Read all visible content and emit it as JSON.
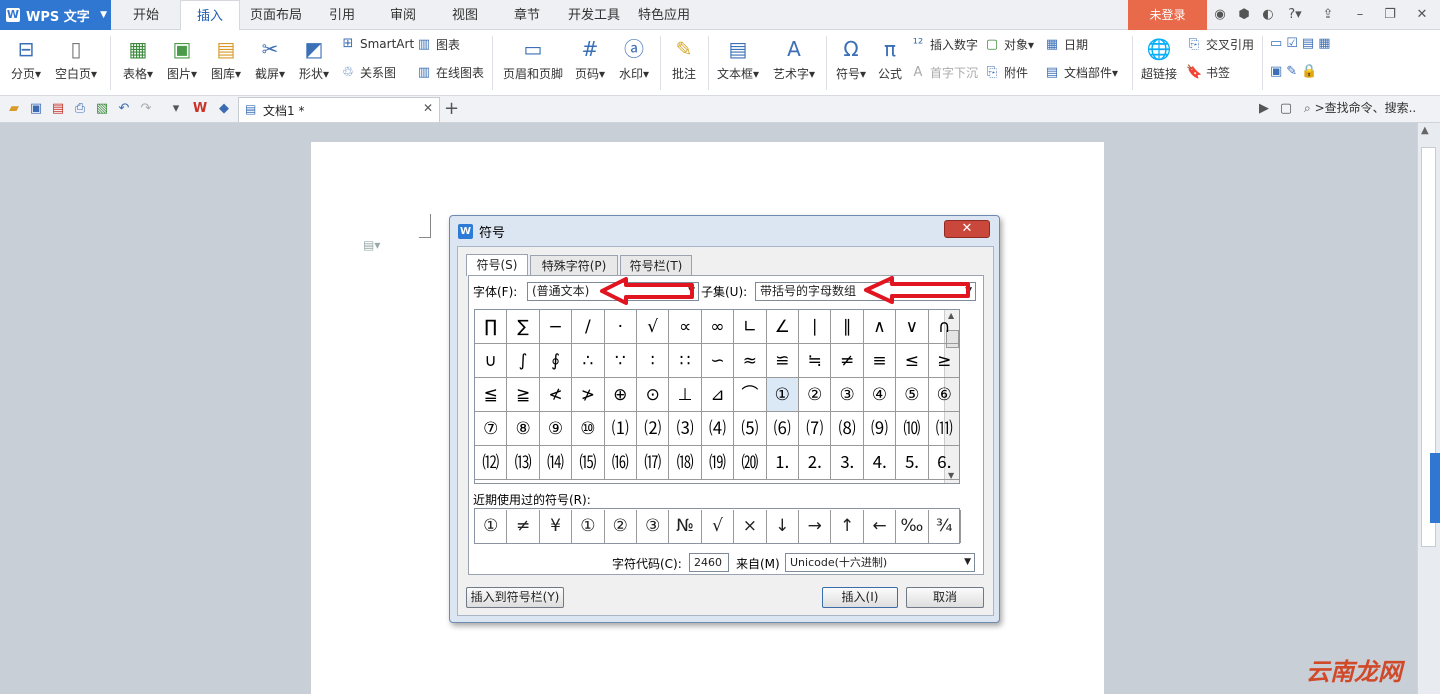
{
  "app": {
    "logo_label": "WPS 文字",
    "login_label": "未登录"
  },
  "menu_tabs": [
    "开始",
    "插入",
    "页面布局",
    "引用",
    "审阅",
    "视图",
    "章节",
    "开发工具",
    "特色应用"
  ],
  "ribbon": {
    "big": [
      "分页",
      "空白页",
      "表格",
      "图片",
      "图库",
      "截屏",
      "形状",
      "页眉和页脚",
      "页码",
      "水印",
      "批注",
      "文本框",
      "艺术字",
      "符号",
      "公式",
      "超链接"
    ],
    "small": [
      "SmartArt",
      "关系图",
      "图表",
      "在线图表",
      "插入数字",
      "首字下沉",
      "对象",
      "附件",
      "日期",
      "文档部件",
      "交叉引用",
      "书签"
    ]
  },
  "doc_tab": {
    "title": "文档1 *"
  },
  "search": {
    "placeholder": ">查找命令、搜索..."
  },
  "dialog": {
    "title": "符号",
    "tabs": [
      "符号(S)",
      "特殊字符(P)",
      "符号栏(T)"
    ],
    "font_label": "字体(F):",
    "font_value": "(普通文本)",
    "subset_label": "子集(U):",
    "subset_value": "带括号的字母数组",
    "grid_symbols": [
      [
        "∏",
        "∑",
        "−",
        "/",
        "·",
        "√",
        "∝",
        "∞",
        "∟",
        "∠",
        "∣",
        "∥",
        "∧",
        "∨",
        "∩"
      ],
      [
        "∪",
        "∫",
        "∮",
        "∴",
        "∵",
        "∶",
        "∷",
        "∽",
        "≈",
        "≌",
        "≒",
        "≠",
        "≡",
        "≤",
        "≥"
      ],
      [
        "≦",
        "≧",
        "≮",
        "≯",
        "⊕",
        "⊙",
        "⊥",
        "⊿",
        "⌒",
        "①",
        "②",
        "③",
        "④",
        "⑤",
        "⑥"
      ],
      [
        "⑦",
        "⑧",
        "⑨",
        "⑩",
        "⑴",
        "⑵",
        "⑶",
        "⑷",
        "⑸",
        "⑹",
        "⑺",
        "⑻",
        "⑼",
        "⑽",
        "⑾"
      ],
      [
        "⑿",
        "⒀",
        "⒁",
        "⒂",
        "⒃",
        "⒄",
        "⒅",
        "⒆",
        "⒇",
        "⒈",
        "⒉",
        "⒊",
        "⒋",
        "⒌",
        "⒍"
      ]
    ],
    "selected": {
      "row": 2,
      "col": 9
    },
    "recent_label": "近期使用过的符号(R):",
    "recent_symbols": [
      "①",
      "≠",
      "¥",
      "①",
      "②",
      "③",
      "№",
      "√",
      "×",
      "↓",
      "→",
      "↑",
      "←",
      "‰",
      "¾"
    ],
    "charcode_label": "字符代码(C):",
    "charcode_value": "2460",
    "from_label": "来自(M)",
    "from_value": "Unicode(十六进制)",
    "insert_to_bar_label": "插入到符号栏(Y)",
    "insert_label": "插入(I)",
    "cancel_label": "取消"
  },
  "watermark": "云南龙网",
  "colors": {
    "accent": "#2f77d1",
    "login": "#e96a4b",
    "annotation_arrow": "#e0151f"
  }
}
